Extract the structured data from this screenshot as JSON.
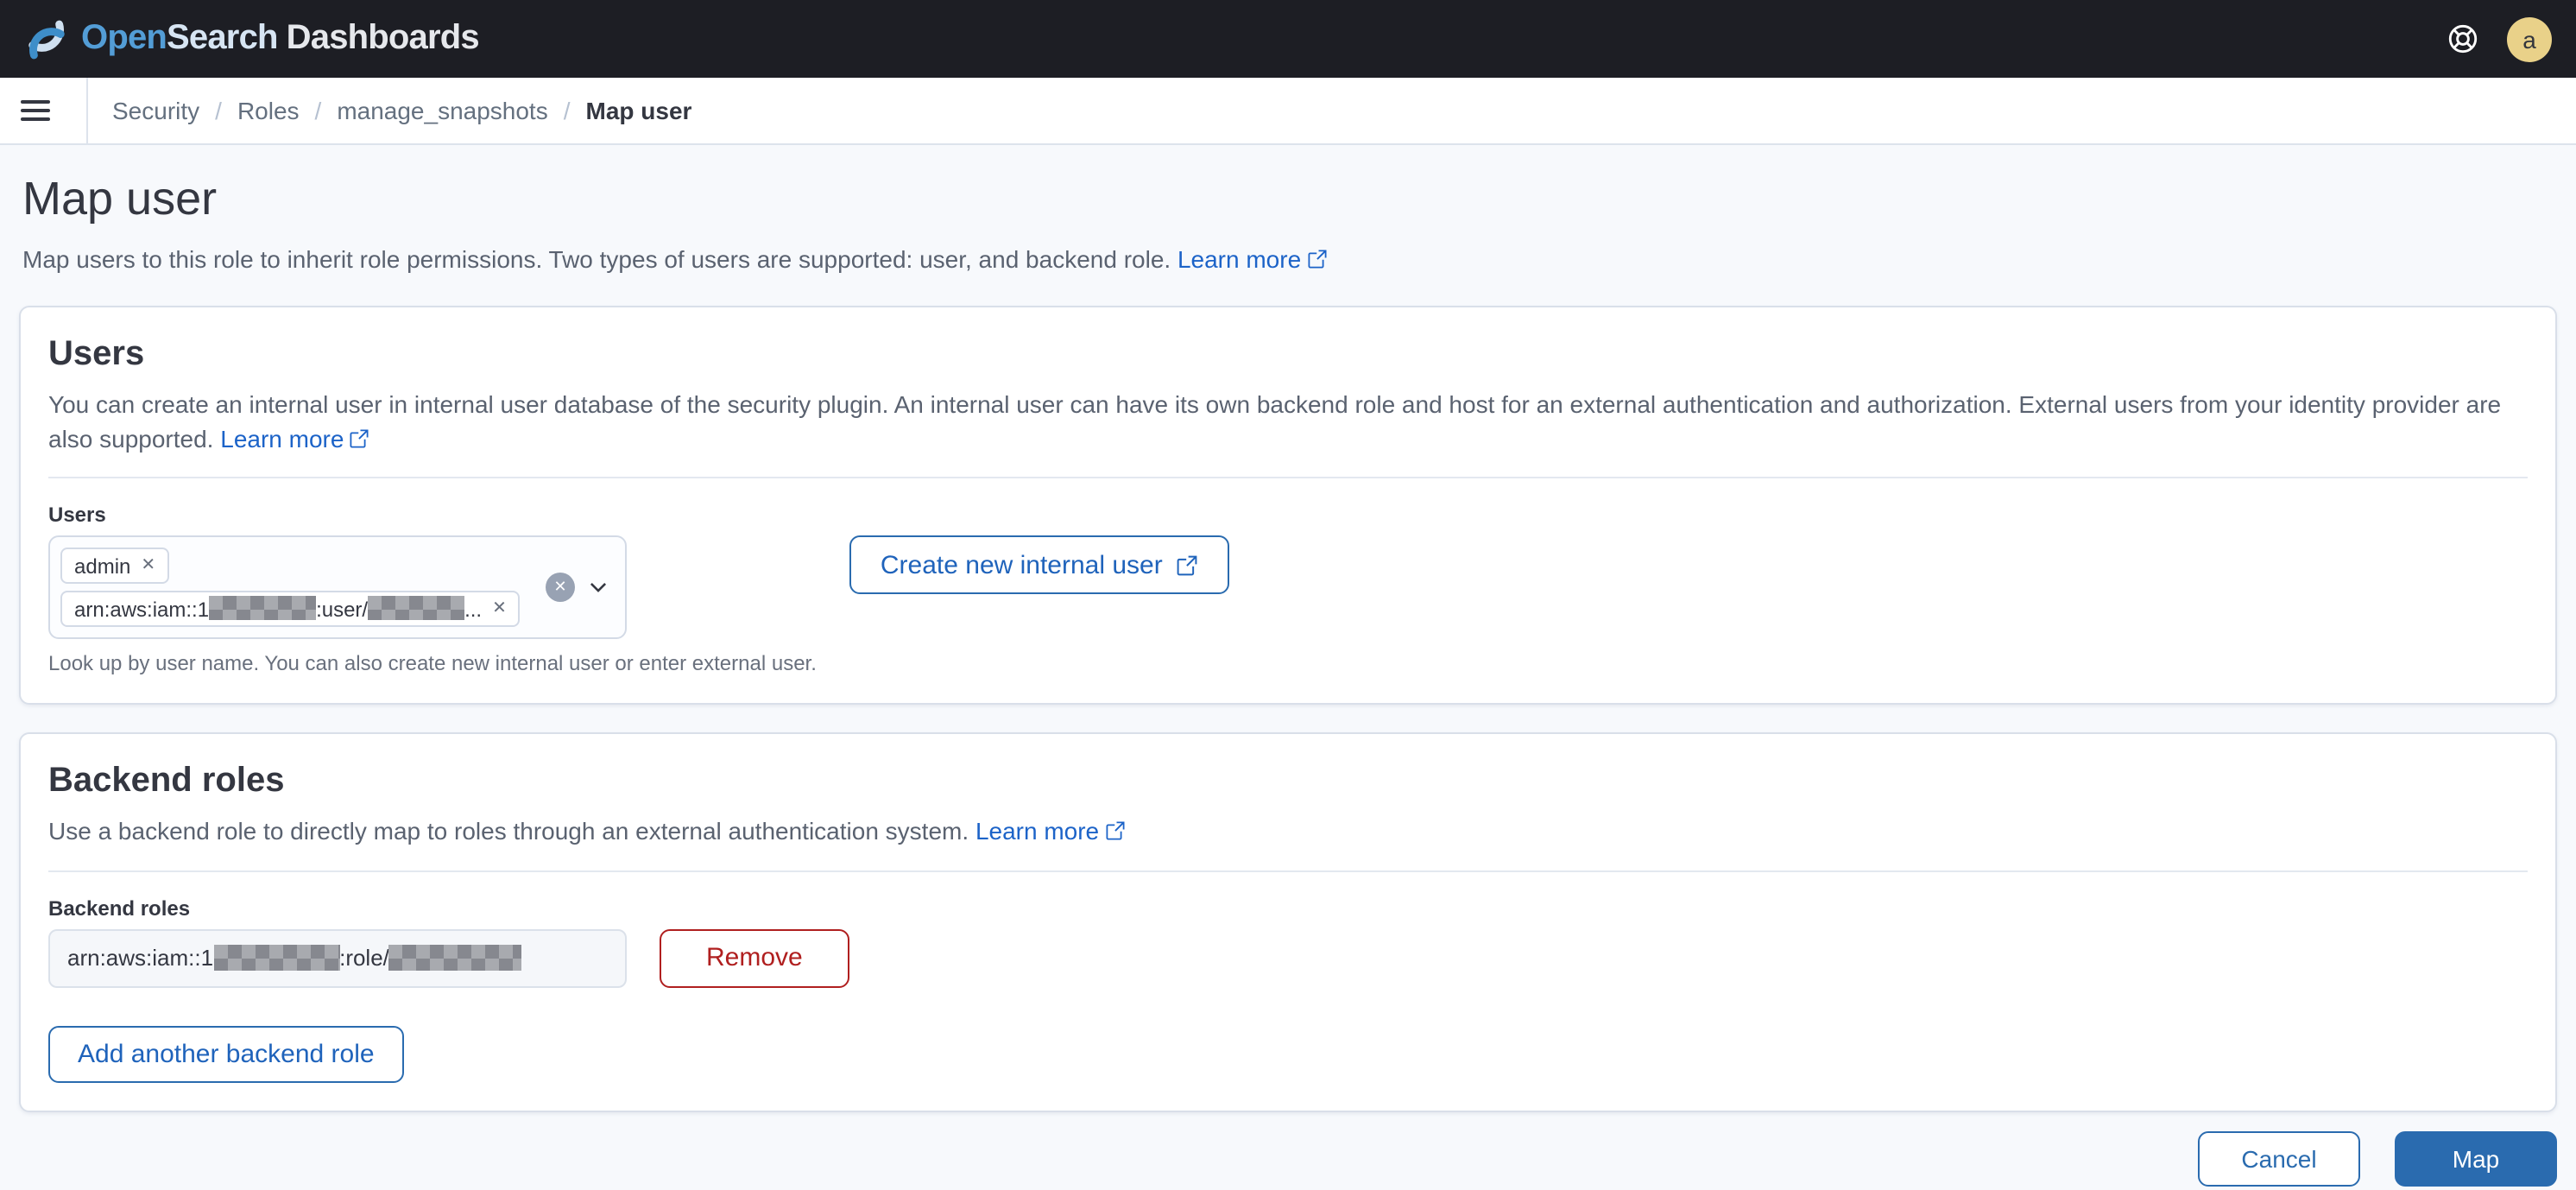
{
  "header": {
    "brand": {
      "open": "Open",
      "search": "Search",
      "product": "Dashboards"
    },
    "avatar_initial": "a"
  },
  "breadcrumbs": {
    "items": [
      "Security",
      "Roles",
      "manage_snapshots"
    ],
    "current": "Map user",
    "separator": "/"
  },
  "page": {
    "title": "Map user",
    "description": "Map users to this role to inherit role permissions. Two types of users are supported: user, and backend role.",
    "learn_more": "Learn more"
  },
  "users_panel": {
    "title": "Users",
    "description": "You can create an internal user in internal user database of the security plugin. An internal user can have its own backend role and host for an external authentication and authorization. External users from your identity provider are also supported.",
    "learn_more": "Learn more",
    "field_label": "Users",
    "pill_admin": "admin",
    "arn_pill": {
      "prefix": "arn:aws:iam::1",
      "mid": ":user/",
      "suffix": "..."
    },
    "create_button": "Create new internal user",
    "help_text": "Look up by user name. You can also create new internal user or enter external user."
  },
  "backend_panel": {
    "title": "Backend roles",
    "description": "Use a backend role to directly map to roles through an external authentication system.",
    "learn_more": "Learn more",
    "field_label": "Backend roles",
    "input": {
      "prefix": "arn:aws:iam::1",
      "mid": ":role/"
    },
    "remove_button": "Remove",
    "add_button": "Add another backend role"
  },
  "footer": {
    "cancel": "Cancel",
    "map": "Map"
  },
  "colors": {
    "header_bg": "#1d1e24",
    "page_bg": "#f7f9fc",
    "panel_border": "#d9dfe9",
    "primary_blue": "#2a6baf",
    "link_blue": "#1c63c8",
    "danger_red": "#b01f1f",
    "avatar_bg": "#e9d189"
  }
}
